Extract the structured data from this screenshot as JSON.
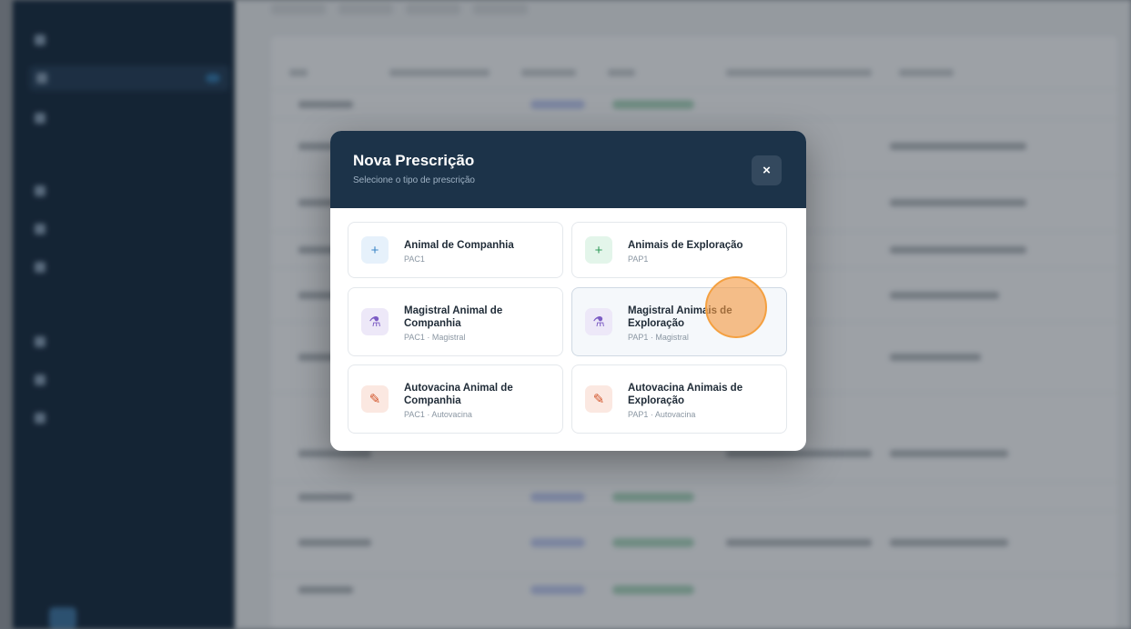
{
  "modal": {
    "title": "Nova Prescrição",
    "subtitle": "Selecione o tipo de prescrição",
    "close_symbol": "×",
    "options": [
      {
        "title": "Animal de Companhia",
        "code": "PAC1",
        "icon": "plus-icon",
        "glyph": "+",
        "color": "#3c86c7"
      },
      {
        "title": "Animais de Exploração",
        "code": "PAP1",
        "icon": "plus-icon",
        "glyph": "+",
        "color": "#2f9a59"
      },
      {
        "title": "Magistral Animal de Companhia",
        "code": "PAC1 · Magistral",
        "icon": "flask-icon",
        "glyph": "⚗",
        "color": "#7c5cc4"
      },
      {
        "title": "Magistral Animais de Exploração",
        "code": "PAP1 · Magistral",
        "icon": "flask-icon",
        "glyph": "⚗",
        "color": "#7c5cc4"
      },
      {
        "title": "Autovacina Animal de Companhia",
        "code": "PAC1 · Autovacina",
        "icon": "syringe-icon",
        "glyph": "✎",
        "color": "#d2552b"
      },
      {
        "title": "Autovacina Animais de Exploração",
        "code": "PAP1 · Autovacina",
        "icon": "syringe-icon",
        "glyph": "✎",
        "color": "#d2552b"
      }
    ]
  },
  "colors": {
    "modal_header": "#1c3349",
    "sidebar": "#15283b"
  }
}
